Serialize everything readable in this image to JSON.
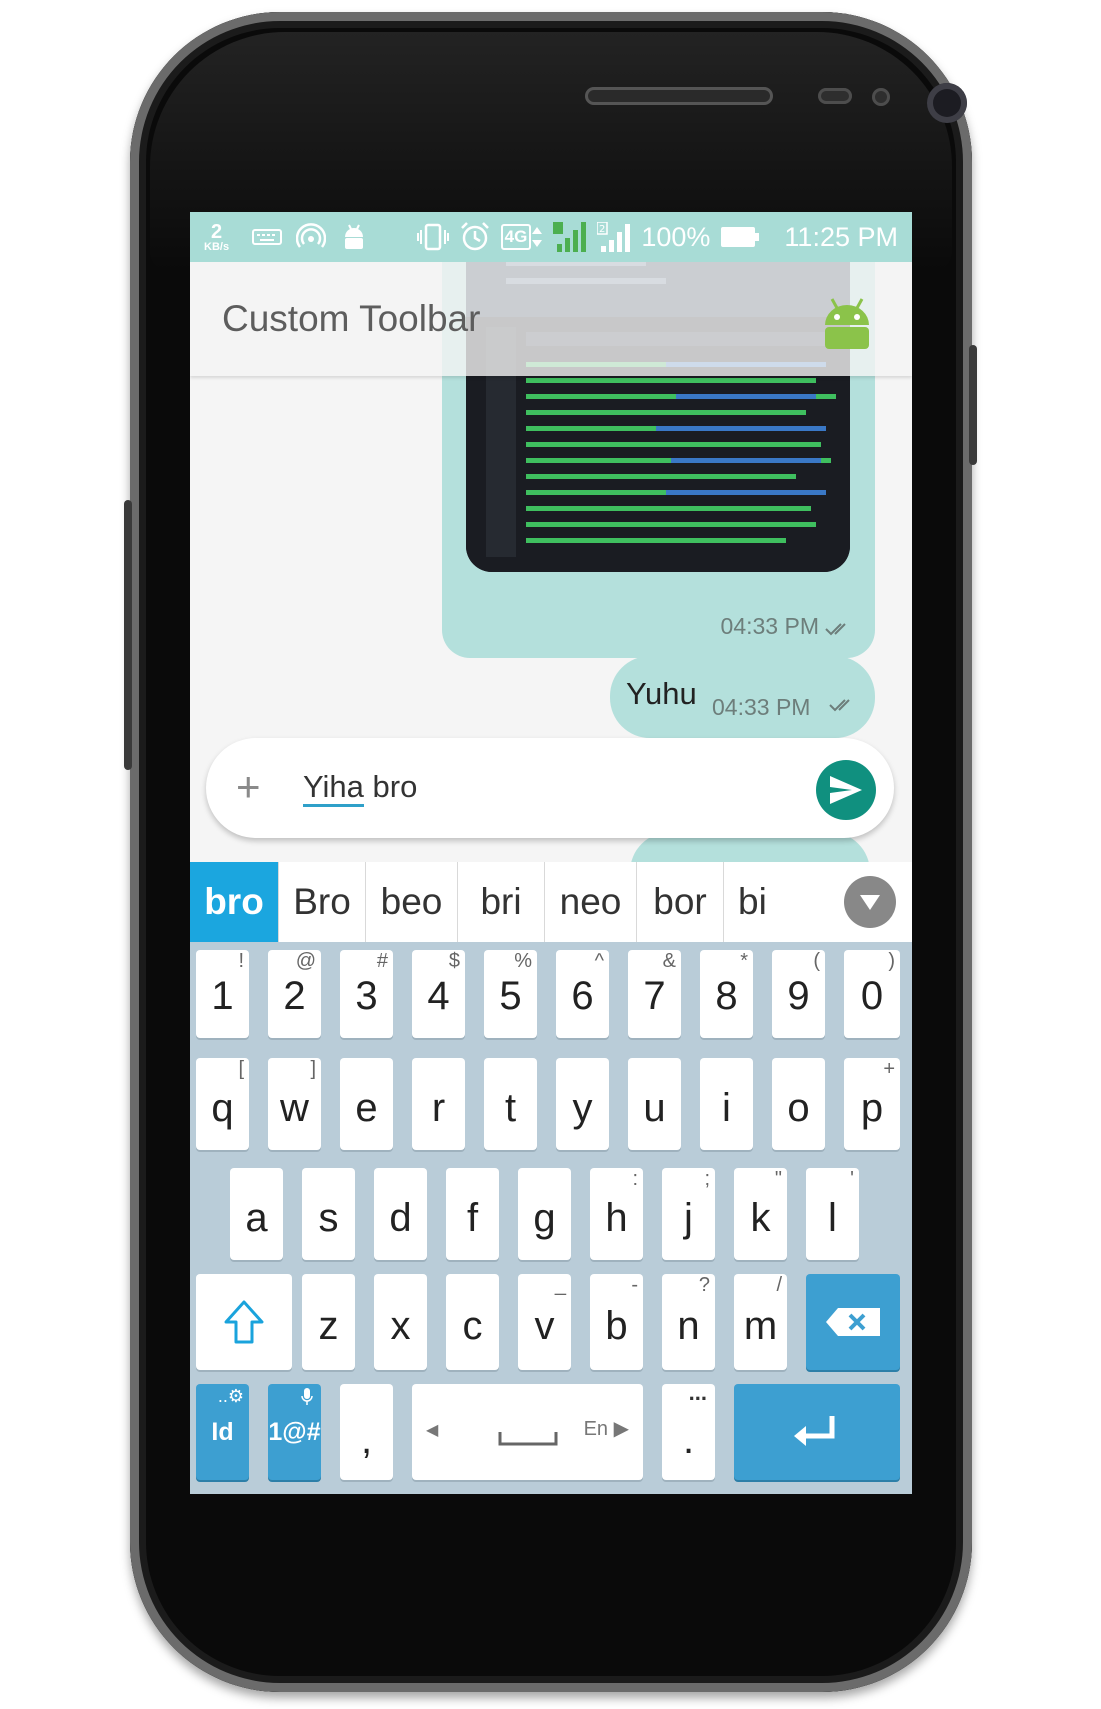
{
  "status_bar": {
    "net_speed_value": "2",
    "net_speed_unit": "KB/s",
    "network": "4G",
    "sim2": "2",
    "battery_pct": "100%",
    "time": "11:25 PM"
  },
  "toolbar": {
    "title": "Custom Toolbar"
  },
  "messages": [
    {
      "type": "image",
      "time": "04:33 PM"
    },
    {
      "type": "text",
      "text": "Yuhu",
      "time": "04:33 PM"
    }
  ],
  "input": {
    "text_underlined": "Yiha",
    "text_rest": " bro",
    "plus_symbol": "+"
  },
  "suggestions": [
    "bro",
    "Bro",
    "beo",
    "bri",
    "neo",
    "bor",
    "bi"
  ],
  "keyboard": {
    "row1": [
      {
        "main": "1",
        "sub": "!"
      },
      {
        "main": "2",
        "sub": "@"
      },
      {
        "main": "3",
        "sub": "#"
      },
      {
        "main": "4",
        "sub": "$"
      },
      {
        "main": "5",
        "sub": "%"
      },
      {
        "main": "6",
        "sub": "^"
      },
      {
        "main": "7",
        "sub": "&"
      },
      {
        "main": "8",
        "sub": "*"
      },
      {
        "main": "9",
        "sub": "("
      },
      {
        "main": "0",
        "sub": ")"
      }
    ],
    "row2": [
      {
        "main": "q",
        "sub": "["
      },
      {
        "main": "w",
        "sub": "]"
      },
      {
        "main": "e",
        "sub": ""
      },
      {
        "main": "r",
        "sub": ""
      },
      {
        "main": "t",
        "sub": ""
      },
      {
        "main": "y",
        "sub": ""
      },
      {
        "main": "u",
        "sub": ""
      },
      {
        "main": "i",
        "sub": ""
      },
      {
        "main": "o",
        "sub": ""
      },
      {
        "main": "p",
        "sub": "+"
      }
    ],
    "row3": [
      {
        "main": "a",
        "sub": ""
      },
      {
        "main": "s",
        "sub": ""
      },
      {
        "main": "d",
        "sub": ""
      },
      {
        "main": "f",
        "sub": ""
      },
      {
        "main": "g",
        "sub": ""
      },
      {
        "main": "h",
        "sub": ":"
      },
      {
        "main": "j",
        "sub": ";"
      },
      {
        "main": "k",
        "sub": "\""
      },
      {
        "main": "l",
        "sub": "'"
      }
    ],
    "row4": [
      {
        "main": "z",
        "sub": ""
      },
      {
        "main": "x",
        "sub": ""
      },
      {
        "main": "c",
        "sub": ""
      },
      {
        "main": "v",
        "sub": "_"
      },
      {
        "main": "b",
        "sub": "-"
      },
      {
        "main": "n",
        "sub": "?"
      },
      {
        "main": "m",
        "sub": "/"
      }
    ],
    "row5": {
      "id_key": "Id",
      "symbols_key": "1@#",
      "comma": ",",
      "lang": "En",
      "period": ".",
      "period_sub": "..."
    }
  },
  "colors": {
    "status_bar": "#a8dcd6",
    "bubble": "#b4e0dc",
    "send_button": "#10907f",
    "suggestion_active": "#1ba6df",
    "keyboard_bg": "#b9ccd8",
    "function_key": "#3d9fd1"
  }
}
